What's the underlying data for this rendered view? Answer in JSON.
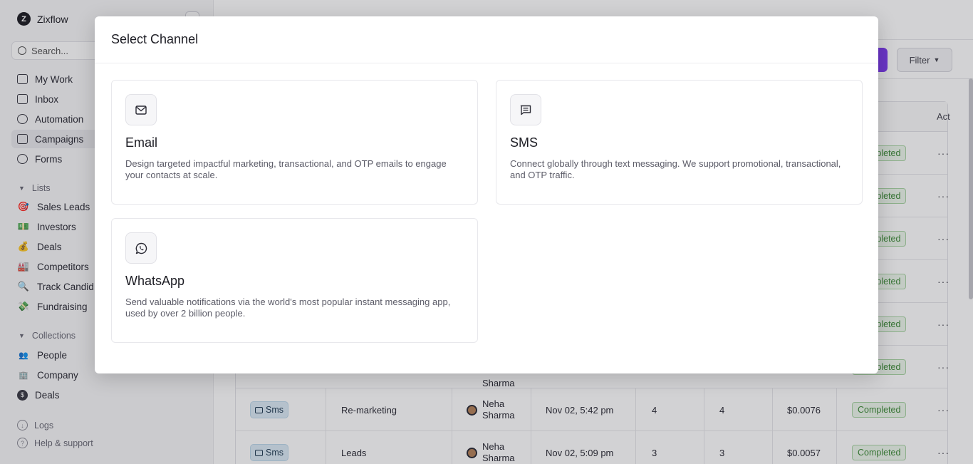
{
  "app": {
    "name": "Zixflow",
    "logo_letter": "Z"
  },
  "sidebar": {
    "search_placeholder": "Search...",
    "nav": [
      {
        "label": "My Work",
        "icon": "checkbox-icon"
      },
      {
        "label": "Inbox",
        "icon": "inbox-icon"
      },
      {
        "label": "Automation",
        "icon": "bulb-icon"
      },
      {
        "label": "Campaigns",
        "icon": "megaphone-icon",
        "active": true
      },
      {
        "label": "Forms",
        "icon": "form-icon"
      }
    ],
    "lists_title": "Lists",
    "lists": [
      {
        "label": "Sales Leads",
        "emoji": "🎯"
      },
      {
        "label": "Investors",
        "emoji": "💵"
      },
      {
        "label": "Deals",
        "emoji": "💰"
      },
      {
        "label": "Competitors",
        "emoji": "🏭"
      },
      {
        "label": "Track Candid",
        "emoji": "🔍"
      },
      {
        "label": "Fundraising",
        "emoji": "💸"
      }
    ],
    "collections_title": "Collections",
    "collections": [
      {
        "label": "People",
        "icon": "people-icon"
      },
      {
        "label": "Company",
        "icon": "company-icon"
      },
      {
        "label": "Deals",
        "icon": "dollar-icon"
      }
    ],
    "footer": [
      {
        "label": "Logs",
        "icon": "logs-icon"
      },
      {
        "label": "Help & support",
        "icon": "help-icon"
      }
    ]
  },
  "main": {
    "filter_label": "Filter",
    "actions_header": "Act",
    "rows": [
      {
        "status": "Completed"
      },
      {
        "status": "Completed"
      },
      {
        "status": "Completed"
      },
      {
        "status": "Completed"
      },
      {
        "status": "Completed"
      },
      {
        "status": "Completed",
        "owner_last": "Sharma"
      },
      {
        "channel": "Sms",
        "name": "Re-marketing",
        "owner_first": "Neha",
        "owner_last": "Sharma",
        "date": "Nov 02, 5:42 pm",
        "count_a": "4",
        "count_b": "4",
        "cost": "$0.0076",
        "status": "Completed"
      },
      {
        "channel": "Sms",
        "name": "Leads",
        "owner_first": "Neha",
        "owner_last": "Sharma",
        "date": "Nov 02, 5:09 pm",
        "count_a": "3",
        "count_b": "3",
        "cost": "$0.0057",
        "status": "Completed"
      }
    ],
    "more_symbol": "···"
  },
  "modal": {
    "title": "Select Channel",
    "channels": [
      {
        "name": "Email",
        "icon": "envelope-icon",
        "description": "Design targeted impactful marketing, transactional, and OTP emails to engage your contacts at scale."
      },
      {
        "name": "SMS",
        "icon": "chat-message-icon",
        "description": "Connect globally through text messaging. We support promotional, transactional, and OTP traffic."
      },
      {
        "name": "WhatsApp",
        "icon": "whatsapp-icon",
        "description": "Send valuable notifications via the world's most popular instant messaging app, used by over 2 billion people."
      }
    ]
  },
  "colors": {
    "accent": "#7c3aed",
    "status_green": "#3d8a37",
    "sms_badge": "#dbeaf5"
  }
}
